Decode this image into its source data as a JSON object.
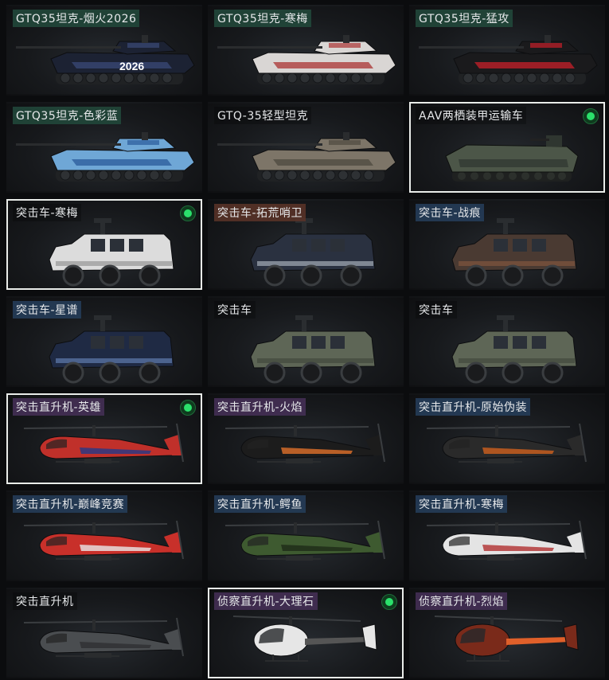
{
  "cards": [
    {
      "label": "GTQ35坦克-烟火2026",
      "vehicle": "tank",
      "tag": "green",
      "selected": false,
      "equipped": false,
      "colors": [
        "#1c2233",
        "#3a4a78"
      ],
      "decal": "2026"
    },
    {
      "label": "GTQ35坦克-寒梅",
      "vehicle": "tank",
      "tag": "green",
      "selected": false,
      "equipped": false,
      "colors": [
        "#d9d6d4",
        "#a33"
      ],
      "decal": ""
    },
    {
      "label": "GTQ35坦克-猛攻",
      "vehicle": "tank",
      "tag": "green",
      "selected": false,
      "equipped": false,
      "colors": [
        "#1a1a1c",
        "#c8202a"
      ],
      "decal": ""
    },
    {
      "label": "GTQ35坦克-色彩蓝",
      "vehicle": "tank",
      "tag": "green",
      "selected": false,
      "equipped": false,
      "colors": [
        "#6fa7d6",
        "#2a5a9a"
      ],
      "decal": ""
    },
    {
      "label": "GTQ-35轻型坦克",
      "vehicle": "tank",
      "tag": "normal",
      "selected": false,
      "equipped": false,
      "colors": [
        "#7d7568",
        "#4e493f"
      ],
      "decal": ""
    },
    {
      "label": "AAV两栖装甲运输车",
      "vehicle": "aav",
      "tag": "normal",
      "selected": true,
      "equipped": true,
      "colors": [
        "#4c5648",
        "#2f3630"
      ],
      "decal": ""
    },
    {
      "label": "突击车-寒梅",
      "vehicle": "truck",
      "tag": "normal",
      "selected": true,
      "equipped": true,
      "colors": [
        "#dcdcdc",
        "#8a8a8a"
      ],
      "decal": ""
    },
    {
      "label": "突击车-拓荒哨卫",
      "vehicle": "truck",
      "tag": "brown",
      "selected": false,
      "equipped": false,
      "colors": [
        "#2a3140",
        "#b9c2cc"
      ],
      "decal": ""
    },
    {
      "label": "突击车-战痕",
      "vehicle": "truck",
      "tag": "blue",
      "selected": false,
      "equipped": false,
      "colors": [
        "#4a3a32",
        "#8a5a40"
      ],
      "decal": ""
    },
    {
      "label": "突击车-星谱",
      "vehicle": "truck",
      "tag": "blue",
      "selected": false,
      "equipped": false,
      "colors": [
        "#1f2a44",
        "#6a8ac0"
      ],
      "decal": ""
    },
    {
      "label": "突击车",
      "vehicle": "truck",
      "tag": "normal",
      "selected": false,
      "equipped": false,
      "colors": [
        "#5e6656",
        "#3d4339"
      ],
      "decal": ""
    },
    {
      "label": "突击车",
      "vehicle": "truck",
      "tag": "normal",
      "selected": false,
      "equipped": false,
      "colors": [
        "#5e6656",
        "#3d4339"
      ],
      "decal": ""
    },
    {
      "label": "突击直升机-英雄",
      "vehicle": "heli",
      "tag": "purple",
      "selected": true,
      "equipped": true,
      "colors": [
        "#c0302a",
        "#233a88"
      ],
      "decal": ""
    },
    {
      "label": "突击直升机-火焰",
      "vehicle": "heli",
      "tag": "purple",
      "selected": false,
      "equipped": false,
      "colors": [
        "#1c1c1c",
        "#e0702a"
      ],
      "decal": ""
    },
    {
      "label": "突击直升机-原始伪装",
      "vehicle": "heli",
      "tag": "blue",
      "selected": false,
      "equipped": false,
      "colors": [
        "#2a2a2a",
        "#d0601e"
      ],
      "decal": ""
    },
    {
      "label": "突击直升机-巅峰竞赛",
      "vehicle": "heli",
      "tag": "blue",
      "selected": false,
      "equipped": false,
      "colors": [
        "#c8302a",
        "#e8e8e8"
      ],
      "decal": ""
    },
    {
      "label": "突击直升机-鳄鱼",
      "vehicle": "heli",
      "tag": "blue",
      "selected": false,
      "equipped": false,
      "colors": [
        "#3e5a30",
        "#1e2a18"
      ],
      "decal": ""
    },
    {
      "label": "突击直升机-寒梅",
      "vehicle": "heli",
      "tag": "blue",
      "selected": false,
      "equipped": false,
      "colors": [
        "#e4e4e4",
        "#b03030"
      ],
      "decal": ""
    },
    {
      "label": "突击直升机",
      "vehicle": "heli",
      "tag": "normal",
      "selected": false,
      "equipped": false,
      "colors": [
        "#4a4d50",
        "#2e3032"
      ],
      "decal": ""
    },
    {
      "label": "侦察直升机-大理石",
      "vehicle": "scout",
      "tag": "purple",
      "selected": true,
      "equipped": true,
      "colors": [
        "#e6e6e6",
        "#555"
      ],
      "decal": ""
    },
    {
      "label": "侦察直升机-烈焰",
      "vehicle": "scout",
      "tag": "purple",
      "selected": false,
      "equipped": false,
      "colors": [
        "#7a2a1a",
        "#e0602a"
      ],
      "decal": ""
    }
  ]
}
